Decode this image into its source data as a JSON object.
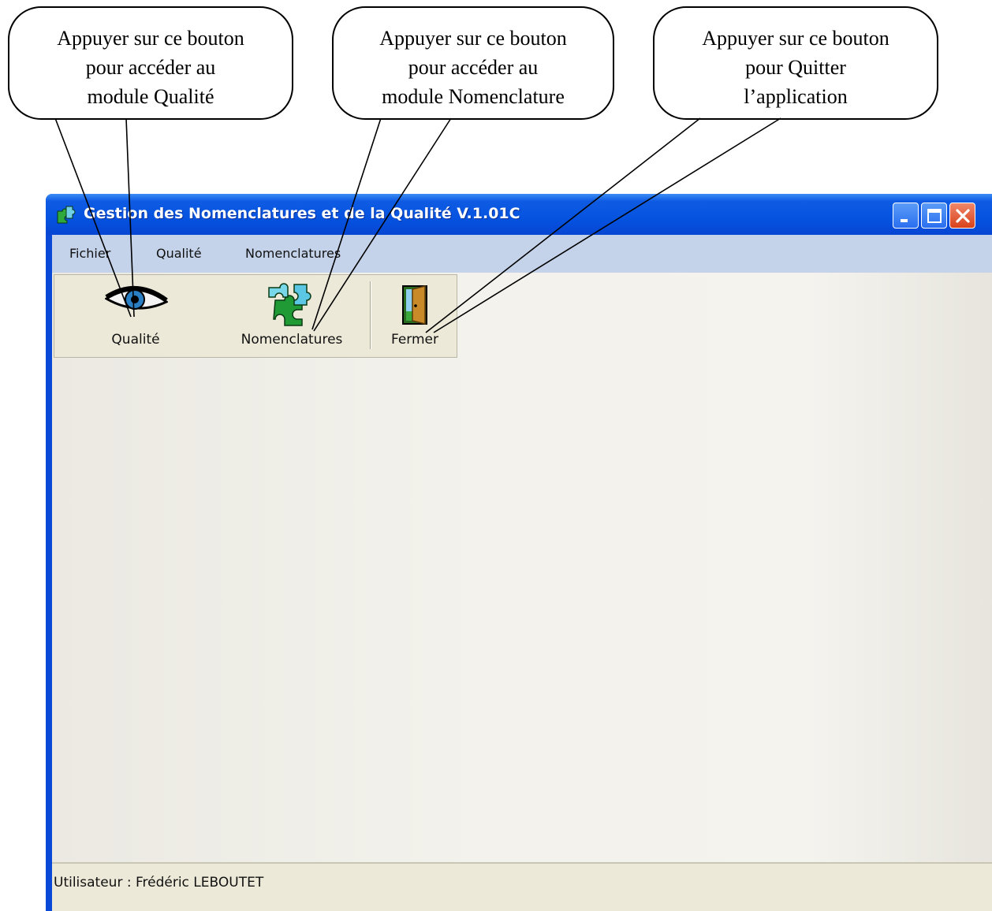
{
  "callouts": [
    {
      "lines": [
        "Appuyer sur ce bouton",
        "pour accéder au",
        "module Qualité"
      ]
    },
    {
      "lines": [
        "Appuyer sur ce bouton",
        "pour accéder au",
        "module Nomenclature"
      ]
    },
    {
      "lines": [
        "Appuyer sur ce bouton",
        "pour Quitter",
        "l’application"
      ]
    }
  ],
  "window": {
    "title": "Gestion des Nomenclatures et de la Qualité V.1.01C",
    "app_icon": "puzzle-icon",
    "controls": [
      "minimize",
      "maximize",
      "close"
    ]
  },
  "menubar": {
    "items": [
      "Fichier",
      "Qualité",
      "Nomenclatures"
    ]
  },
  "toolbar": {
    "buttons": [
      {
        "label": "Qualité",
        "icon": "eye-icon"
      },
      {
        "label": "Nomenclatures",
        "icon": "puzzle-icon"
      },
      {
        "label": "Fermer",
        "icon": "door-icon"
      }
    ]
  },
  "statusbar": {
    "text": "Utilisateur : Frédéric LEBOUTET"
  },
  "colors": {
    "titlebar": "#0553e0",
    "menubar": "#c4d3ea",
    "toolbar": "#ece9d8",
    "close_button": "#d8421b"
  }
}
